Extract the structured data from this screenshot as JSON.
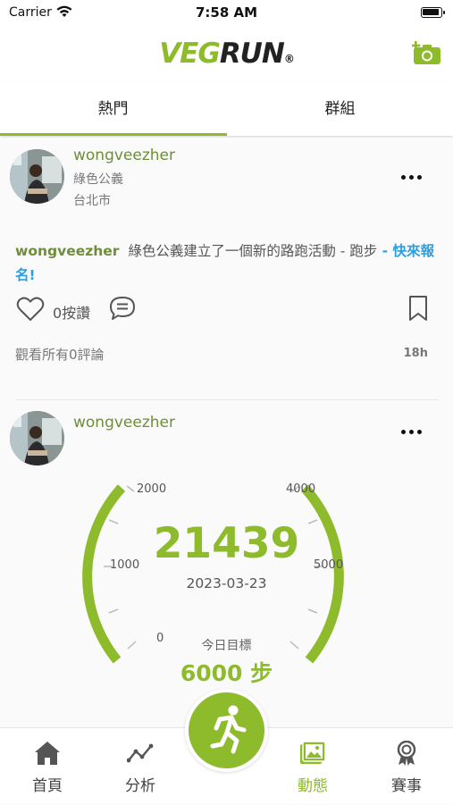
{
  "status_bar": {
    "carrier": "Carrier",
    "time": "7:58 AM"
  },
  "header": {
    "logo_part1": "VEG",
    "logo_part2": "RUN",
    "logo_mark": "®"
  },
  "tabs": [
    {
      "label": "熱門",
      "active": true
    },
    {
      "label": "群組",
      "active": false
    }
  ],
  "posts": [
    {
      "username": "wongveezher",
      "group": "綠色公義",
      "location": "台北市",
      "text_name": "wongveezher",
      "text_body": "綠色公義建立了一個新的路跑活動 - 跑步",
      "text_link": " - 快來報名!",
      "likes_label": "0按讚",
      "comments_label": "觀看所有0評論",
      "time": "18h"
    },
    {
      "username": "wongveezher",
      "gauge": {
        "steps": "21439",
        "date": "2023-03-23",
        "goal_label": "今日目標",
        "goal": "6000 步",
        "goal_value": 6000,
        "tick_labels": [
          "0",
          "1000",
          "2000",
          "4000",
          "5000"
        ]
      }
    }
  ],
  "bottom_nav": [
    {
      "label": "首頁",
      "icon": "home-icon",
      "active": false
    },
    {
      "label": "分析",
      "icon": "analytics-icon",
      "active": false
    },
    {
      "label": "動態",
      "icon": "feed-icon",
      "active": true
    },
    {
      "label": "賽事",
      "icon": "medal-icon",
      "active": false
    }
  ],
  "colors": {
    "accent": "#8dbb2b",
    "link": "#2d9ee0",
    "username": "#6e8e3a"
  }
}
